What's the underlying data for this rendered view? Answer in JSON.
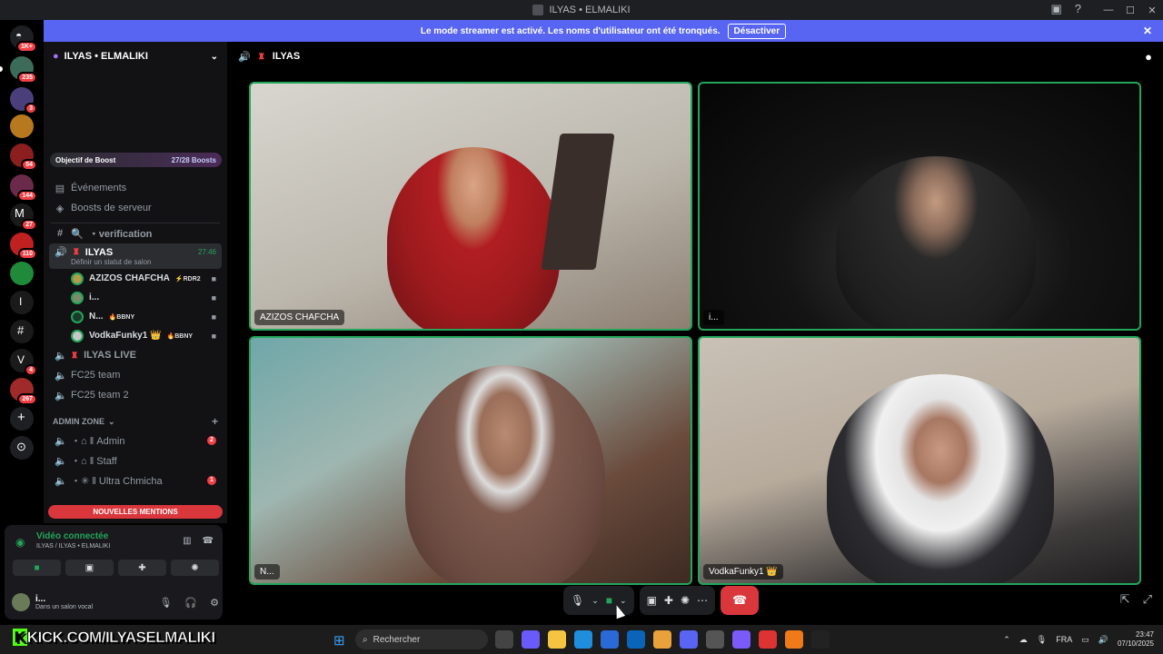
{
  "window": {
    "title": "ILYAS • ELMALIKI"
  },
  "banner": {
    "message": "Le mode streamer est activé. Les noms d'utilisateur ont été tronqués.",
    "button": "Désactiver"
  },
  "rail": {
    "servers": [
      {
        "badge": "1K+",
        "color": "#2b2d31"
      },
      {
        "badge": "235",
        "color": "#3d6b5a"
      },
      {
        "badge": "3",
        "color": "#4a3f7a"
      },
      {
        "badge": "",
        "color": "#b8791e"
      },
      {
        "badge": "54",
        "color": "#8b1e1e"
      },
      {
        "badge": "144",
        "color": "#6b2a4a"
      },
      {
        "badge": "27",
        "color": "#1a1a1a"
      },
      {
        "badge": "110",
        "color": "#c02020"
      },
      {
        "badge": "",
        "color": "#1f8a3a"
      },
      {
        "badge": "",
        "color": "#1a1a1a"
      },
      {
        "badge": "",
        "color": "#1a1a1a"
      },
      {
        "badge": "4",
        "color": "#1a1a1a"
      },
      {
        "badge": "267",
        "color": "#a02a2a"
      }
    ],
    "letters": {
      "i": "I",
      "v": "V"
    }
  },
  "sidebar": {
    "server_name": "ILYAS • ELMALIKI",
    "boost_label": "Objectif de Boost",
    "boost_value": "27/28 Boosts",
    "events": "Événements",
    "boosts": "Boosts de serveur",
    "verification": "・verification",
    "active_channel": {
      "name": "ILYAS",
      "time": "27:46",
      "status": "Définir un statut de salon"
    },
    "voice_users": [
      {
        "name": "AZIZOS CHAFCHA",
        "tag": "⚡RDR2"
      },
      {
        "name": "i...",
        "tag": ""
      },
      {
        "name": "N...",
        "tag": "🔥BBNY"
      },
      {
        "name": "VodkaFunky1 👑",
        "tag": "🔥BBNY"
      }
    ],
    "channels": [
      "ILYAS LIVE",
      "FC25 team",
      "FC25 team 2"
    ],
    "category": "ADMIN ZONE",
    "admin_channels": [
      {
        "name": "・⌂ ‖ Admin",
        "badge": "2"
      },
      {
        "name": "・⌂ ‖ Staff",
        "badge": ""
      },
      {
        "name": "・✳ ‖ Ultra Chmicha",
        "badge": "1"
      }
    ],
    "mentions": "NOUVELLES MENTIONS"
  },
  "voice_panel": {
    "status": "Vidéo connectée",
    "location": "ILYAS / ILYAS • ELMALIKI",
    "user_name": "i...",
    "user_status": "Dans un salon vocal"
  },
  "main": {
    "channel": "ILYAS",
    "tiles": [
      {
        "name": "AZIZOS CHAFCHA"
      },
      {
        "name": "i..."
      },
      {
        "name": "N..."
      },
      {
        "name": "VodkaFunky1 👑"
      }
    ]
  },
  "taskbar": {
    "kick_text": "KICK.COM/ILYASELMALIKI",
    "search": "Rechercher",
    "lang": "FRA",
    "time": "23:47",
    "date": "07/10/2025"
  },
  "colors": {
    "accent": "#5865f2",
    "green": "#23a55a",
    "red": "#da373c"
  }
}
